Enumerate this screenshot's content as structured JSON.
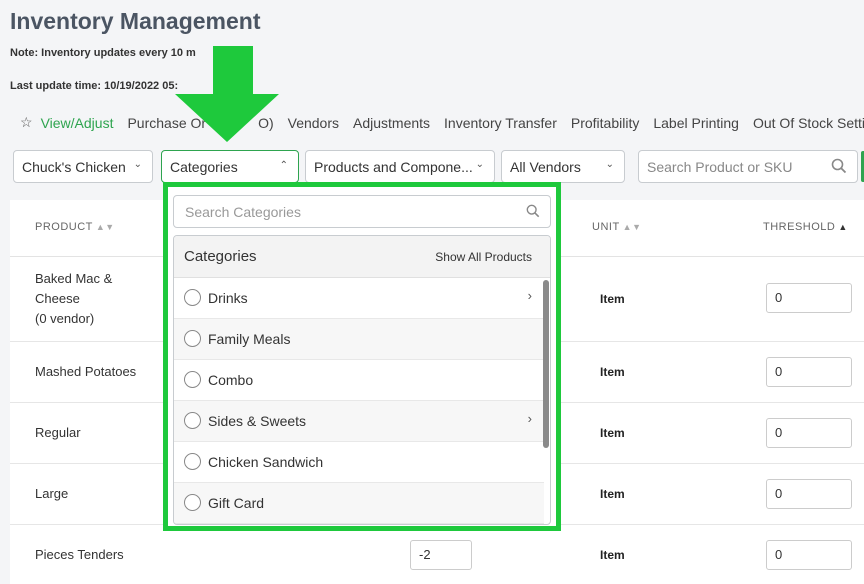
{
  "header": {
    "title": "Inventory Management",
    "note": "Note: Inventory updates every 10 m",
    "last_update": "Last update time: 10/19/2022 05:"
  },
  "tabs": [
    {
      "label": "View/Adjust",
      "active": true
    },
    {
      "label": "Purchase Or"
    },
    {
      "label": "O)"
    },
    {
      "label": "Vendors"
    },
    {
      "label": "Adjustments"
    },
    {
      "label": "Inventory Transfer"
    },
    {
      "label": "Profitability"
    },
    {
      "label": "Label Printing"
    },
    {
      "label": "Out Of Stock Setting"
    }
  ],
  "filters": {
    "location": "Chuck's Chicken",
    "categories": "Categories",
    "products": "Products and Compone...",
    "vendors": "All Vendors",
    "search_placeholder": "Search Product or SKU"
  },
  "table": {
    "columns": {
      "product": "PRODUCT",
      "unit": "UNIT",
      "threshold": "THRESHOLD"
    },
    "rows": [
      {
        "product": "Baked Mac &\nCheese\n(0 vendor)",
        "unit": "Item",
        "threshold": "0",
        "qty": ""
      },
      {
        "product": "Mashed Potatoes",
        "unit": "Item",
        "threshold": "0",
        "qty": ""
      },
      {
        "product": "Regular",
        "unit": "Item",
        "threshold": "0",
        "qty": ""
      },
      {
        "product": "Large",
        "unit": "Item",
        "threshold": "0",
        "qty": ""
      },
      {
        "product": "Pieces Tenders",
        "unit": "Item",
        "threshold": "0",
        "qty": "-2"
      }
    ]
  },
  "dropdown": {
    "search_placeholder": "Search Categories",
    "header_title": "Categories",
    "show_all": "Show All Products",
    "items": [
      {
        "label": "Drinks",
        "has_children": true
      },
      {
        "label": "Family Meals",
        "has_children": false
      },
      {
        "label": "Combo",
        "has_children": false
      },
      {
        "label": "Sides & Sweets",
        "has_children": true
      },
      {
        "label": "Chicken Sandwich",
        "has_children": false
      },
      {
        "label": "Gift Card",
        "has_children": false
      }
    ]
  },
  "colors": {
    "accent_green": "#2ea44f",
    "highlight_green": "#1ec93c"
  }
}
